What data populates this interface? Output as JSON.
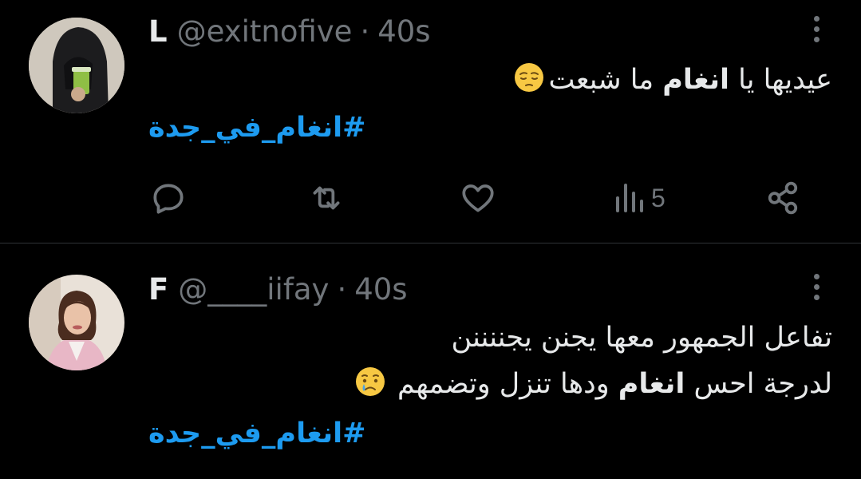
{
  "tweets": [
    {
      "name": "L",
      "handle": "@exitnofive",
      "separator": "·",
      "time": "40s",
      "text_line1_before": "عيديها يا ",
      "text_line1_bold": "انغام",
      "text_line1_after": " ما شبعت",
      "emoji": "pensive-face",
      "hashtag": "#انغام_في_جدة",
      "views": "5"
    },
    {
      "name": "F",
      "handle": "@____iifay",
      "separator": "·",
      "time": "40s",
      "text_line1": "تفاعل الجمهور معها يجنن يجننننن",
      "text_line2_before": "لدرجة احس ",
      "text_line2_bold": "انغام",
      "text_line2_after": " ودها تنزل وتضمهم",
      "emoji": "crying-face",
      "hashtag": "#انغام_في_جدة"
    }
  ],
  "colors": {
    "background": "#000000",
    "text": "#e7e9ea",
    "muted": "#71767b",
    "link": "#1d9bf0",
    "divider": "#2f3336"
  }
}
